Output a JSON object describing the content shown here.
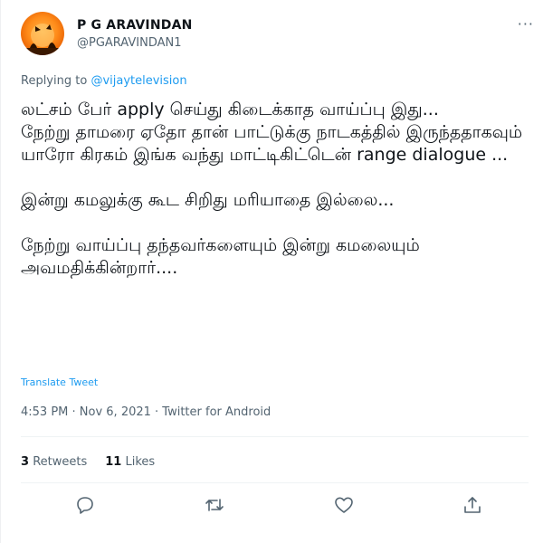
{
  "user": {
    "name": "P G ARAVINDAN",
    "handle": "@PGARAVINDAN1"
  },
  "more_label": "···",
  "reply": {
    "prefix": "Replying to ",
    "mention": "@vijaytelevision"
  },
  "tweet_text": "லட்சம் பேர் apply செய்து கிடைக்காத வாய்ப்பு இது...\nநேற்று தாமரை ஏதோ தான் பாட்டுக்கு நாடகத்தில் இருந்ததாகவும் யாரோ கிரகம் இங்க வந்து மாட்டிகிட்டென் range dialogue ...\n\nஇன்று கமலுக்கு கூட சிறிது மரியாதை இல்லை...\n\nநேற்று வாய்ப்பு தந்தவர்களையும் இன்று கமலையும் அவமதிக்கின்றார்....",
  "translate_label": "Translate Tweet",
  "meta": "4:53 PM · Nov 6, 2021 · Twitter for Android",
  "stats": {
    "retweets_count": "3",
    "retweets_label": "Retweets",
    "likes_count": "11",
    "likes_label": "Likes"
  },
  "icons": {
    "reply": "reply-icon",
    "retweet": "retweet-icon",
    "like": "heart-icon",
    "share": "share-icon"
  },
  "colors": {
    "accent": "#1d9bf0",
    "secondary_text": "#536471",
    "primary_text": "#0f1419"
  }
}
